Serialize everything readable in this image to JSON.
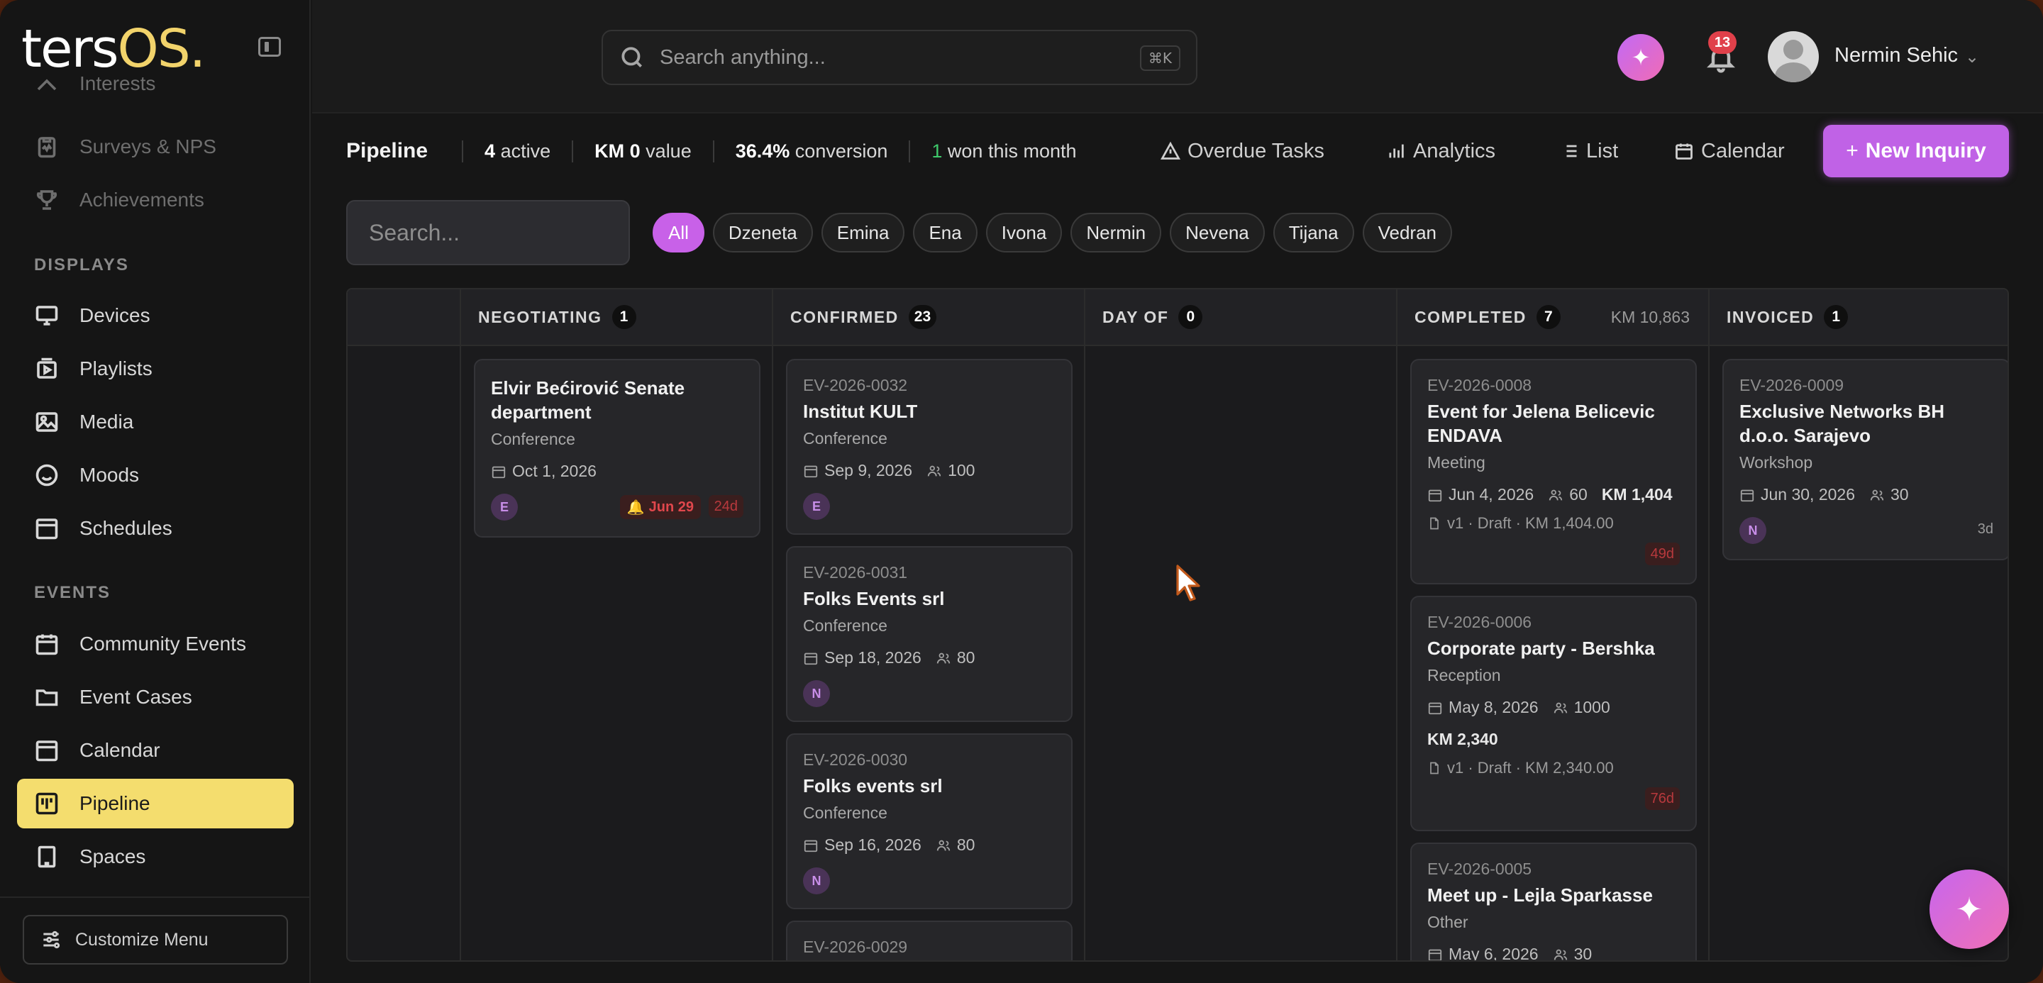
{
  "brand": {
    "logo_main": "ters",
    "logo_accent": "OS."
  },
  "sidebar": {
    "top_items": [
      {
        "label": "Interests"
      },
      {
        "label": "Surveys & NPS"
      },
      {
        "label": "Achievements"
      }
    ],
    "section_displays": "DISPLAYS",
    "displays": [
      {
        "label": "Devices"
      },
      {
        "label": "Playlists"
      },
      {
        "label": "Media"
      },
      {
        "label": "Moods"
      },
      {
        "label": "Schedules"
      }
    ],
    "section_events": "EVENTS",
    "events": [
      {
        "label": "Community Events"
      },
      {
        "label": "Event Cases"
      },
      {
        "label": "Calendar"
      },
      {
        "label": "Pipeline"
      },
      {
        "label": "Spaces"
      }
    ],
    "customize": "Customize Menu"
  },
  "topbar": {
    "search_placeholder": "Search anything...",
    "shortcut": "⌘K",
    "notifications_count": "13",
    "user_name": "Nermin Sehic"
  },
  "pipeline": {
    "title": "Pipeline",
    "active_num": "4",
    "active_label": "active",
    "value_num": "KM 0",
    "value_label": "value",
    "conversion_num": "36.4%",
    "conversion_label": "conversion",
    "won_num": "1",
    "won_label": "won this month",
    "overdue": "Overdue Tasks",
    "analytics": "Analytics",
    "list": "List",
    "calendar": "Calendar",
    "new_inquiry": "New Inquiry"
  },
  "filters": {
    "search_placeholder": "Search...",
    "chips": [
      "All",
      "Dzeneta",
      "Emina",
      "Ena",
      "Ivona",
      "Nermin",
      "Nevena",
      "Tijana",
      "Vedran"
    ]
  },
  "columns": {
    "negotiating": {
      "label": "NEGOTIATING",
      "count": "1"
    },
    "confirmed": {
      "label": "CONFIRMED",
      "count": "23"
    },
    "dayof": {
      "label": "DAY OF",
      "count": "0"
    },
    "completed": {
      "label": "COMPLETED",
      "count": "7",
      "sum": "KM 10,863"
    },
    "invoiced": {
      "label": "INVOICED",
      "count": "1"
    }
  },
  "cards": {
    "neg1": {
      "title": "Elvir Bećirović Senate department",
      "type": "Conference",
      "date": "Oct 1, 2026",
      "initial": "E",
      "reminder": "Jun 29",
      "days": "24d"
    },
    "con1": {
      "code": "EV-2026-0032",
      "title": "Institut KULT",
      "type": "Conference",
      "date": "Sep 9, 2026",
      "guests": "100",
      "initial": "E"
    },
    "con2": {
      "code": "EV-2026-0031",
      "title": "Folks Events srl",
      "type": "Conference",
      "date": "Sep 18, 2026",
      "guests": "80",
      "initial": "N"
    },
    "con3": {
      "code": "EV-2026-0030",
      "title": "Folks events srl",
      "type": "Conference",
      "date": "Sep 16, 2026",
      "guests": "80",
      "initial": "N"
    },
    "con4": {
      "code": "EV-2026-0029"
    },
    "comp1": {
      "code": "EV-2026-0008",
      "title": "Event for Jelena Belicevic ENDAVA",
      "type": "Meeting",
      "date": "Jun 4, 2026",
      "guests": "60",
      "price": "KM 1,404",
      "draft": "v1 · Draft · KM 1,404.00",
      "days": "49d"
    },
    "comp2": {
      "code": "EV-2026-0006",
      "title": "Corporate party - Bershka",
      "type": "Reception",
      "date": "May 8, 2026",
      "guests": "1000",
      "price": "KM 2,340",
      "draft": "v1 · Draft · KM 2,340.00",
      "days": "76d"
    },
    "comp3": {
      "code": "EV-2026-0005",
      "title": "Meet up - Lejla Sparkasse",
      "type": "Other",
      "date": "May 6, 2026",
      "guests": "30"
    },
    "inv1": {
      "code": "EV-2026-0009",
      "title": "Exclusive Networks BH d.o.o. Sarajevo",
      "type": "Workshop",
      "date": "Jun 30, 2026",
      "guests": "30",
      "initial": "N",
      "days": "3d"
    }
  }
}
